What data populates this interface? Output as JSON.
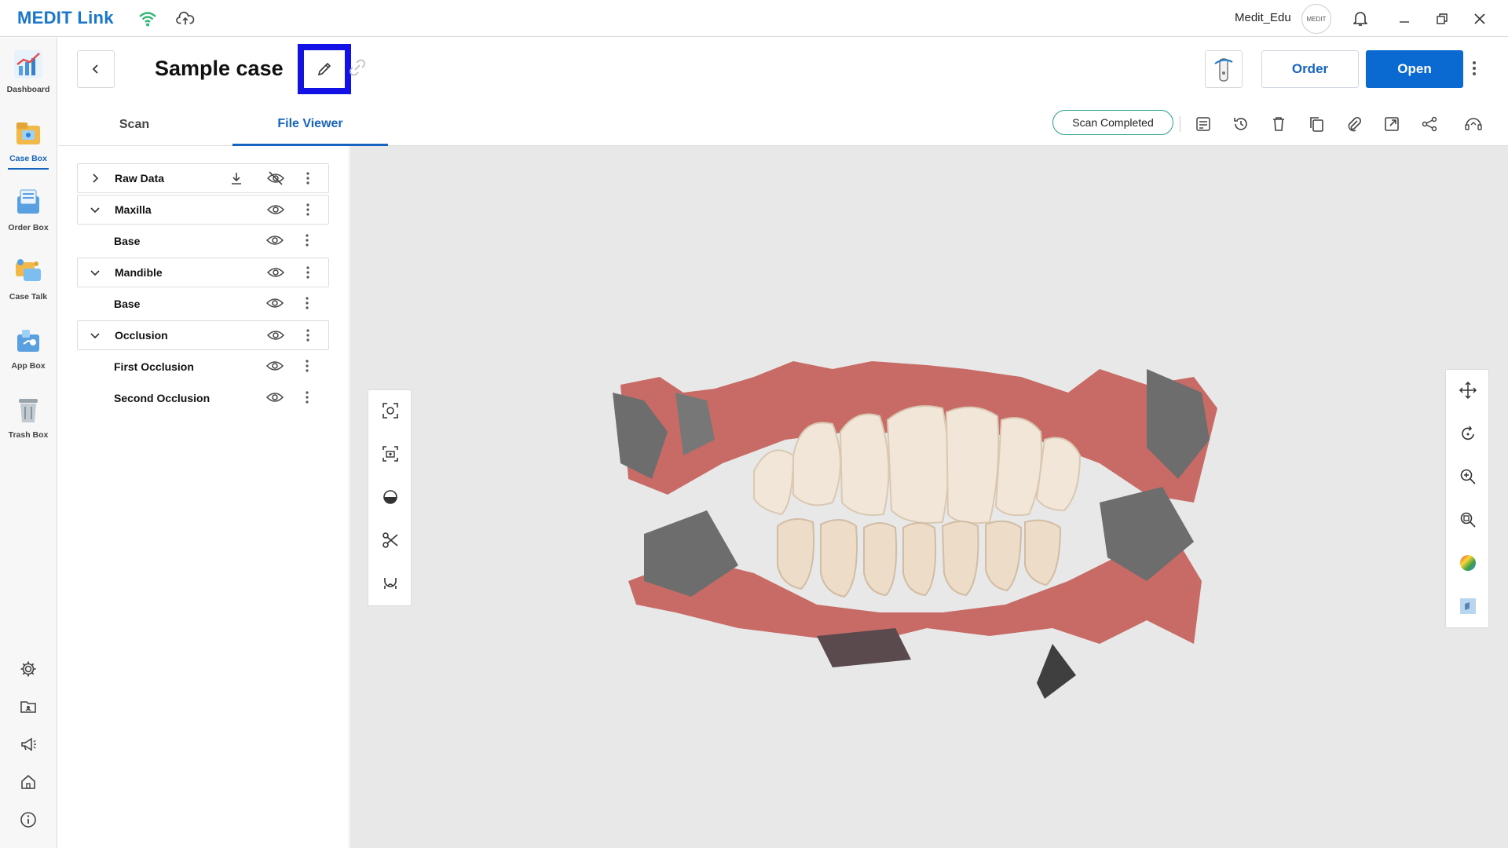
{
  "app": {
    "logo": "MEDIT Link",
    "username": "Medit_Edu",
    "avatar_text": "MEDIT"
  },
  "sidebar": {
    "items": [
      {
        "label": "Dashboard",
        "icon": "dashboard-icon"
      },
      {
        "label": "Case Box",
        "icon": "case-box-icon",
        "active": true
      },
      {
        "label": "Order Box",
        "icon": "order-box-icon"
      },
      {
        "label": "Case Talk",
        "icon": "case-talk-icon"
      },
      {
        "label": "App Box",
        "icon": "app-box-icon"
      },
      {
        "label": "Trash Box",
        "icon": "trash-box-icon"
      }
    ],
    "bottom_icons": [
      "settings-icon",
      "folder-icon",
      "megaphone-icon",
      "home-icon",
      "info-icon"
    ]
  },
  "header": {
    "case_title": "Sample case",
    "order_label": "Order",
    "open_label": "Open",
    "tabs": [
      {
        "label": "Scan"
      },
      {
        "label": "File Viewer",
        "active": true
      }
    ],
    "status": "Scan Completed"
  },
  "tree": {
    "rows": [
      {
        "label": "Raw Data",
        "type": "group",
        "expanded": false,
        "visible": false
      },
      {
        "label": "Maxilla",
        "type": "group",
        "expanded": true,
        "visible": true
      },
      {
        "label": "Base",
        "type": "child",
        "visible": true
      },
      {
        "label": "Mandible",
        "type": "group",
        "expanded": true,
        "visible": true
      },
      {
        "label": "Base",
        "type": "child",
        "visible": true
      },
      {
        "label": "Occlusion",
        "type": "group",
        "expanded": true,
        "visible": true
      },
      {
        "label": "First Occlusion",
        "type": "child",
        "visible": true
      },
      {
        "label": "Second Occlusion",
        "type": "child",
        "visible": true
      }
    ]
  },
  "colors": {
    "accent": "#0b6ad1",
    "highlight_border": "#1212e6",
    "status_border": "#2a9d8f",
    "viewer_bg": "#e8e8e8"
  }
}
